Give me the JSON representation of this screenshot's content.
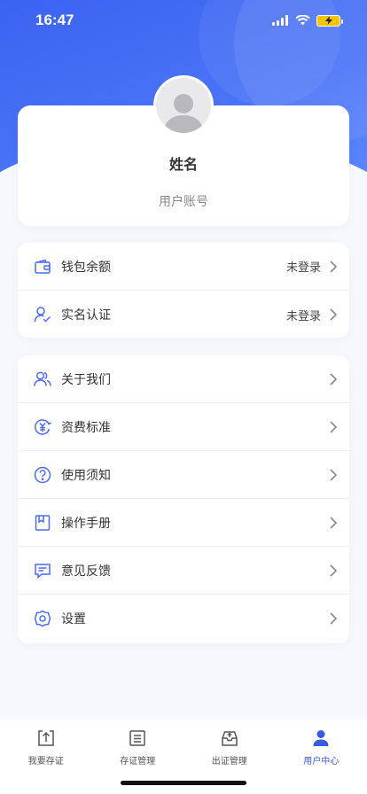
{
  "status_bar": {
    "time": "16:47"
  },
  "profile": {
    "name": "姓名",
    "account": "用户账号"
  },
  "account_items": [
    {
      "label": "钱包余额",
      "value": "未登录",
      "icon": "wallet-icon"
    },
    {
      "label": "实名认证",
      "value": "未登录",
      "icon": "user-verify-icon"
    }
  ],
  "menu_items": [
    {
      "label": "关于我们",
      "icon": "users-icon"
    },
    {
      "label": "资费标准",
      "icon": "yuan-icon"
    },
    {
      "label": "使用须知",
      "icon": "question-icon"
    },
    {
      "label": "操作手册",
      "icon": "bookmark-icon"
    },
    {
      "label": "意见反馈",
      "icon": "message-icon"
    },
    {
      "label": "设置",
      "icon": "settings-icon"
    }
  ],
  "tabs": [
    {
      "label": "我要存证",
      "icon": "upload-icon",
      "active": false
    },
    {
      "label": "存证管理",
      "icon": "list-box-icon",
      "active": false
    },
    {
      "label": "出证管理",
      "icon": "inbox-icon",
      "active": false
    },
    {
      "label": "用户中心",
      "icon": "user-icon",
      "active": true
    }
  ],
  "colors": {
    "accent": "#3b5bdb",
    "hero": "#4a74f7",
    "icon_blue": "#4a6cf7"
  }
}
